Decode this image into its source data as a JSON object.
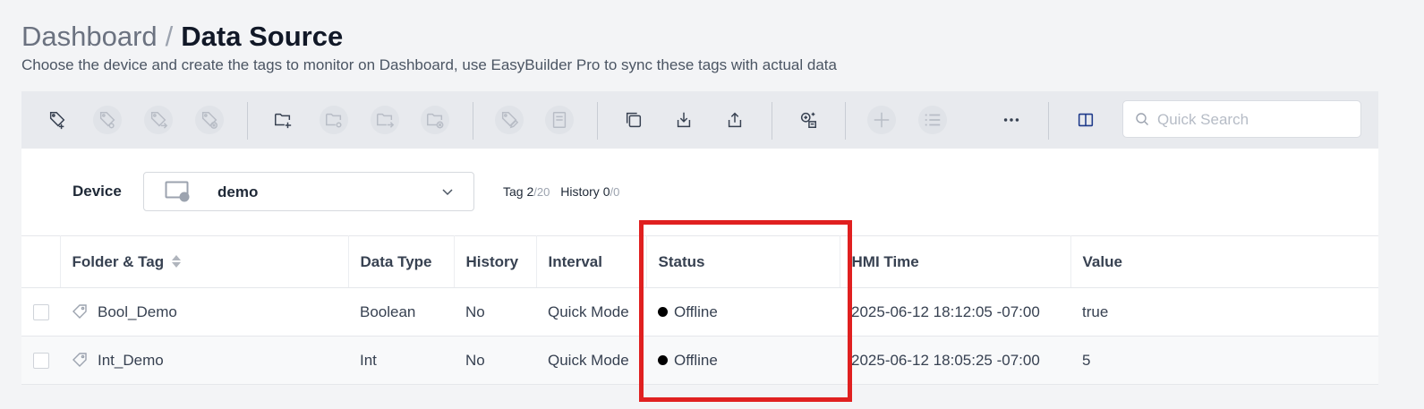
{
  "breadcrumb": {
    "parent": "Dashboard",
    "separator": "/",
    "current": "Data Source"
  },
  "subtitle": "Choose the device and create the tags to monitor on Dashboard, use EasyBuilder Pro to sync these tags with actual data",
  "toolbar": {
    "icons": [
      "add-tag-icon",
      "tag-settings-icon",
      "tag-move-icon",
      "tag-delete-icon",
      "add-folder-icon",
      "folder-settings-icon",
      "folder-move-icon",
      "folder-delete-icon",
      "tag-edit-icon",
      "save-icon",
      "copy-icon",
      "import-icon",
      "export-icon",
      "sync-icon",
      "plus-icon",
      "list-icon",
      "more-icon",
      "column-layout-icon"
    ],
    "search_placeholder": "Quick Search"
  },
  "device": {
    "label": "Device",
    "selected": "demo",
    "tag_label": "Tag",
    "tag_count": "2",
    "tag_max": "/20",
    "history_label": "History",
    "history_count": "0",
    "history_max": "/0"
  },
  "table": {
    "headers": [
      "Folder & Tag",
      "Data Type",
      "History",
      "Interval",
      "Status",
      "HMI Time",
      "Value"
    ],
    "rows": [
      {
        "name": "Bool_Demo",
        "type": "Boolean",
        "history": "No",
        "interval": "Quick Mode",
        "status": "Offline",
        "hmi_time": "2025-06-12 18:12:05 -07:00",
        "value": "true"
      },
      {
        "name": "Int_Demo",
        "type": "Int",
        "history": "No",
        "interval": "Quick Mode",
        "status": "Offline",
        "hmi_time": "2025-06-12 18:05:25 -07:00",
        "value": "5"
      }
    ]
  },
  "colors": {
    "highlight": "#e02020",
    "status_offline": "#000000",
    "background": "#f3f4f6"
  }
}
